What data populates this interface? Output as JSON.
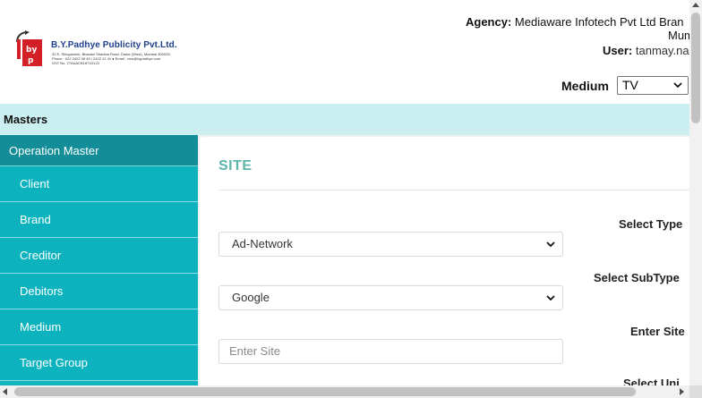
{
  "header": {
    "logo": {
      "title": "B.Y.Padhye Publicity Pvt.Ltd.",
      "line1": "32 E, Shivganesh, Bhavani Shankar Road, Dadar (West), Mumbai 400028.",
      "line2": "Phone : 022 2422 06 45 / 2422 12 41  ●  Email : vizu@bypadhye.com",
      "line3": "GST No. 27AAACB1871D1Z2",
      "brand_color": "#d32027"
    },
    "agency_label": "Agency:",
    "agency_value": "Mediaware Infotech Pvt Ltd Bran",
    "agency_value_cont": "Mum",
    "user_label": "User:",
    "user_value": "tanmay.na",
    "medium_label": "Medium",
    "medium_selected": "TV"
  },
  "masters_bar": {
    "label": "Masters"
  },
  "sidebar": {
    "heading": "Operation Master",
    "items": [
      {
        "label": "Client"
      },
      {
        "label": "Brand"
      },
      {
        "label": "Creditor"
      },
      {
        "label": "Debitors"
      },
      {
        "label": "Medium"
      },
      {
        "label": "Target Group"
      }
    ]
  },
  "main": {
    "title": "SITE",
    "fields": {
      "type_label": "Select Type",
      "type_value": "Ad-Network",
      "subtype_label": "Select SubType",
      "subtype_value": "Google",
      "site_label": "Enter Site",
      "site_placeholder": "Enter Site",
      "unit_label": "Select Uni"
    }
  },
  "colors": {
    "masters_bar": "#cbeef0",
    "sidebar": "#0fb5bf",
    "sidebar_heading": "#138e98",
    "title": "#5bb5a8"
  },
  "icons": {
    "dropdown": "chevron-down-icon",
    "logo": "company-logo-icon"
  }
}
